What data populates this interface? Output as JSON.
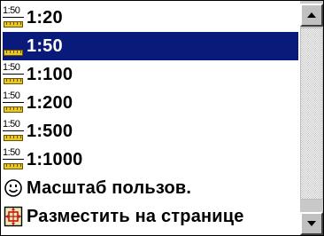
{
  "scale_list": {
    "items": [
      {
        "icon": "scale-1-50-icon",
        "icon_text": "1:50",
        "label": "1:20",
        "selected": false
      },
      {
        "icon": "scale-1-50-icon",
        "icon_text": "1:50",
        "label": "1:50",
        "selected": true
      },
      {
        "icon": "scale-1-50-icon",
        "icon_text": "1:50",
        "label": "1:100",
        "selected": false
      },
      {
        "icon": "scale-1-50-icon",
        "icon_text": "1:50",
        "label": "1:200",
        "selected": false
      },
      {
        "icon": "scale-1-50-icon",
        "icon_text": "1:50",
        "label": "1:500",
        "selected": false
      },
      {
        "icon": "scale-1-50-icon",
        "icon_text": "1:50",
        "label": "1:1000",
        "selected": false
      },
      {
        "icon": "smiley-user-icon",
        "label": "Масштаб пользов.",
        "selected": false
      },
      {
        "icon": "fit-to-page-icon",
        "label": "Разместить на странице",
        "selected": false
      }
    ],
    "selected_index": 1
  },
  "scrollbar": {
    "up_icon": "arrow-up-icon",
    "down_icon": "arrow-down-icon",
    "scroll_position": 0.06
  },
  "colors": {
    "selection_bg": "#0a1a7a",
    "ruler_yellow": "#e8c828",
    "window_bg": "#ffffff",
    "scrollbar_face": "#c0c0c0"
  }
}
